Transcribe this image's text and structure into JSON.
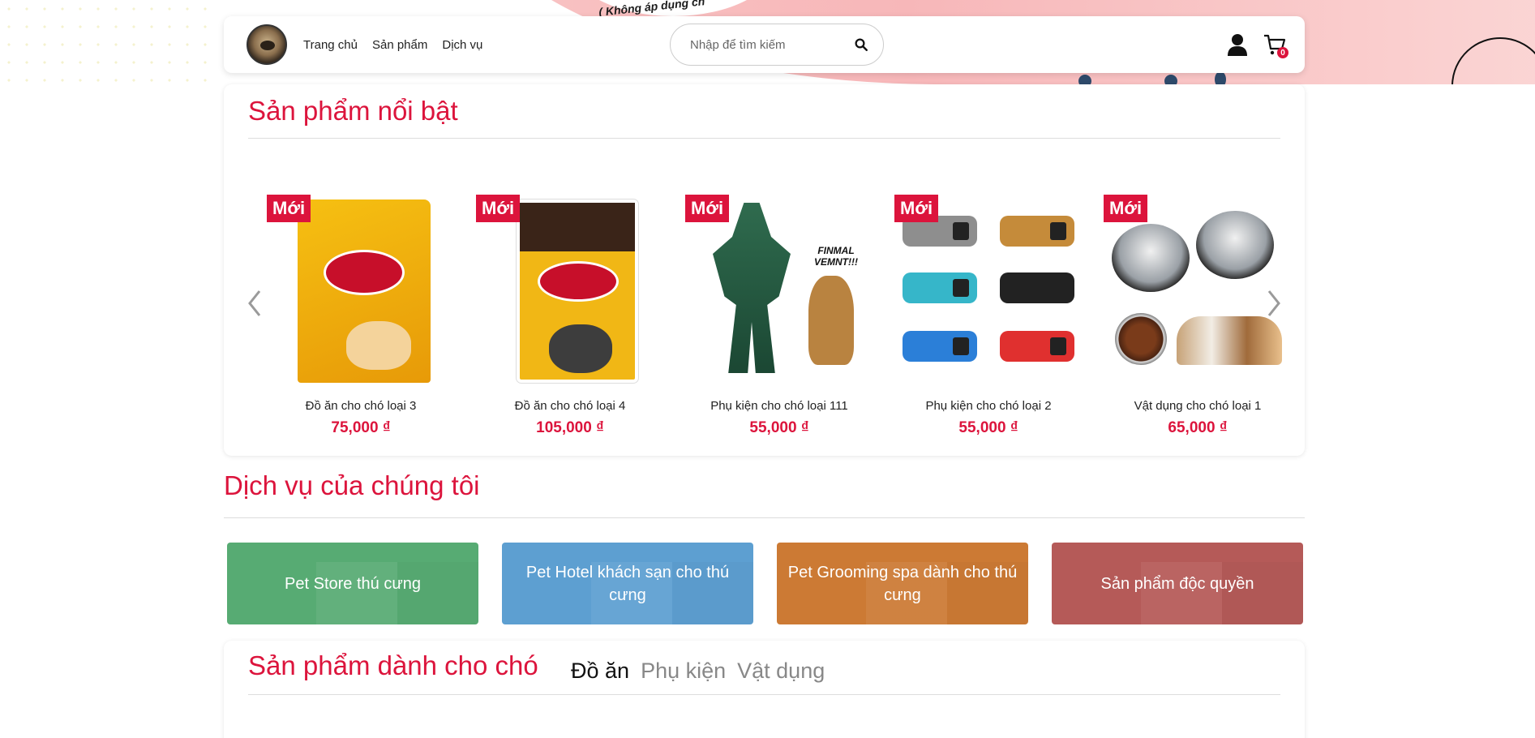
{
  "hero": {
    "promo_text": "( Không áp dụng ch"
  },
  "nav": {
    "links": [
      "Trang chủ",
      "Sản phẩm",
      "Dịch vụ"
    ],
    "search_placeholder": "Nhập để tìm kiếm",
    "cart_count": "0"
  },
  "featured": {
    "title": "Sản phẩm nổi bật",
    "products": [
      {
        "badge": "Mới",
        "name": "Đồ ăn cho chó loại 3",
        "price": "75,000 ₫"
      },
      {
        "badge": "Mới",
        "name": "Đồ ăn cho chó loại 4",
        "price": "105,000 ₫"
      },
      {
        "badge": "Mới",
        "name": "Phụ kiện cho chó loại 111",
        "price": "55,000 ₫",
        "image_text": "FINMAL VEMNT!!!"
      },
      {
        "badge": "Mới",
        "name": "Phụ kiện cho chó loại 2",
        "price": "55,000 ₫"
      },
      {
        "badge": "Mới",
        "name": "Vật dụng cho chó loại 1",
        "price": "65,000 ₫"
      }
    ]
  },
  "services": {
    "title": "Dịch vụ của chúng tôi",
    "items": [
      {
        "label": "Pet Store thú cưng",
        "color": "#57ab73"
      },
      {
        "label": "Pet Hotel khách sạn cho thú cưng",
        "color": "#5d9fd1"
      },
      {
        "label": "Pet Grooming spa dành cho thú cưng",
        "color": "#cc7a34"
      },
      {
        "label": "Sản phẩm độc quyền",
        "color": "#b55a58"
      }
    ]
  },
  "dog_products": {
    "title": "Sản phẩm dành cho chó",
    "tabs": [
      "Đồ ăn",
      "Phụ kiện",
      "Vật dụng"
    ]
  },
  "colors": {
    "accent": "#dc143c"
  }
}
